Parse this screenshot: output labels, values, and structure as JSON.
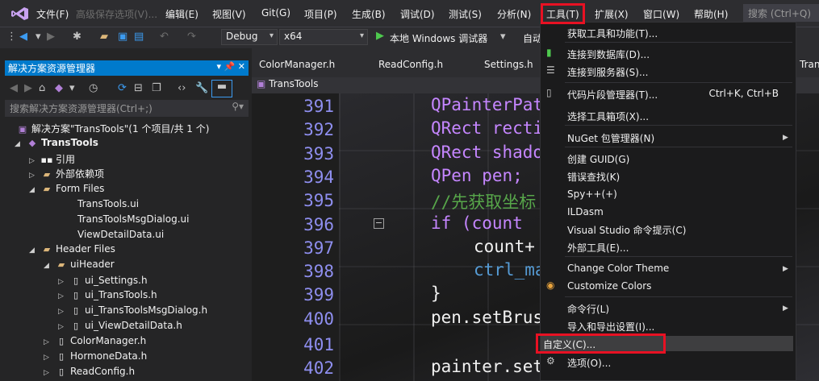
{
  "menubar": {
    "items": [
      "文件(F)",
      "高级保存选项(V)...",
      "编辑(E)",
      "视图(V)",
      "Git(G)",
      "项目(P)",
      "生成(B)",
      "调试(D)",
      "测试(S)",
      "分析(N)",
      "工具(T)",
      "扩展(X)",
      "窗口(W)",
      "帮助(H)"
    ],
    "search_placeholder": "搜索 (Ctrl+Q)"
  },
  "toolbar": {
    "config": "Debug",
    "platform": "x64",
    "run_label": "本地 Windows 调试器",
    "auto_label": "自动"
  },
  "solution_explorer": {
    "title": "解决方案资源管理器",
    "search_placeholder": "搜索解决方案资源管理器(Ctrl+;)",
    "items": [
      "解决方案\"TransTools\"(1 个项目/共 1 个)",
      "TransTools",
      "引用",
      "外部依赖项",
      "Form Files",
      "TransTools.ui",
      "TransToolsMsgDialog.ui",
      "ViewDetailData.ui",
      "Header Files",
      "uiHeader",
      "ui_Settings.h",
      "ui_TransTools.h",
      "ui_TransToolsMsgDialog.h",
      "ui_ViewDetailData.h",
      "ColorManager.h",
      "HormoneData.h",
      "ReadConfig.h"
    ]
  },
  "tabs": [
    "ColorManager.h",
    "ReadConfig.h",
    "Settings.h",
    "Tran"
  ],
  "file_nav": "TransTools",
  "editor": {
    "line_numbers": [
      "391",
      "392",
      "393",
      "394",
      "395",
      "396",
      "397",
      "398",
      "399",
      "400",
      "401",
      "402"
    ],
    "lines": [
      "QPainterPat",
      "QRect recti",
      "QRect shado",
      "QPen pen;",
      "//先获取坐标",
      "if (count ",
      "count+",
      "ctrl_ma",
      "}",
      "pen.setBrus",
      "",
      "painter.set"
    ]
  },
  "tools_menu": {
    "items": [
      "获取工具和功能(T)...",
      "连接到数据库(D)...",
      "连接到服务器(S)...",
      "代码片段管理器(T)...",
      "选择工具箱项(X)...",
      "NuGet 包管理器(N)",
      "创建 GUID(G)",
      "错误查找(K)",
      "Spy++(+)",
      "ILDasm",
      "Visual Studio 命令提示(C)",
      "外部工具(E)...",
      "Change Color Theme",
      "Customize Colors",
      "命令行(L)",
      "导入和导出设置(I)...",
      "自定义(C)...",
      "选项(O)..."
    ],
    "shortcut_snippets": "Ctrl+K, Ctrl+B"
  },
  "colors": {
    "accent": "#007acc",
    "highlight": "#e81123",
    "keyword": "#569cd6",
    "type": "#c586ff",
    "comment": "#57a64a"
  }
}
